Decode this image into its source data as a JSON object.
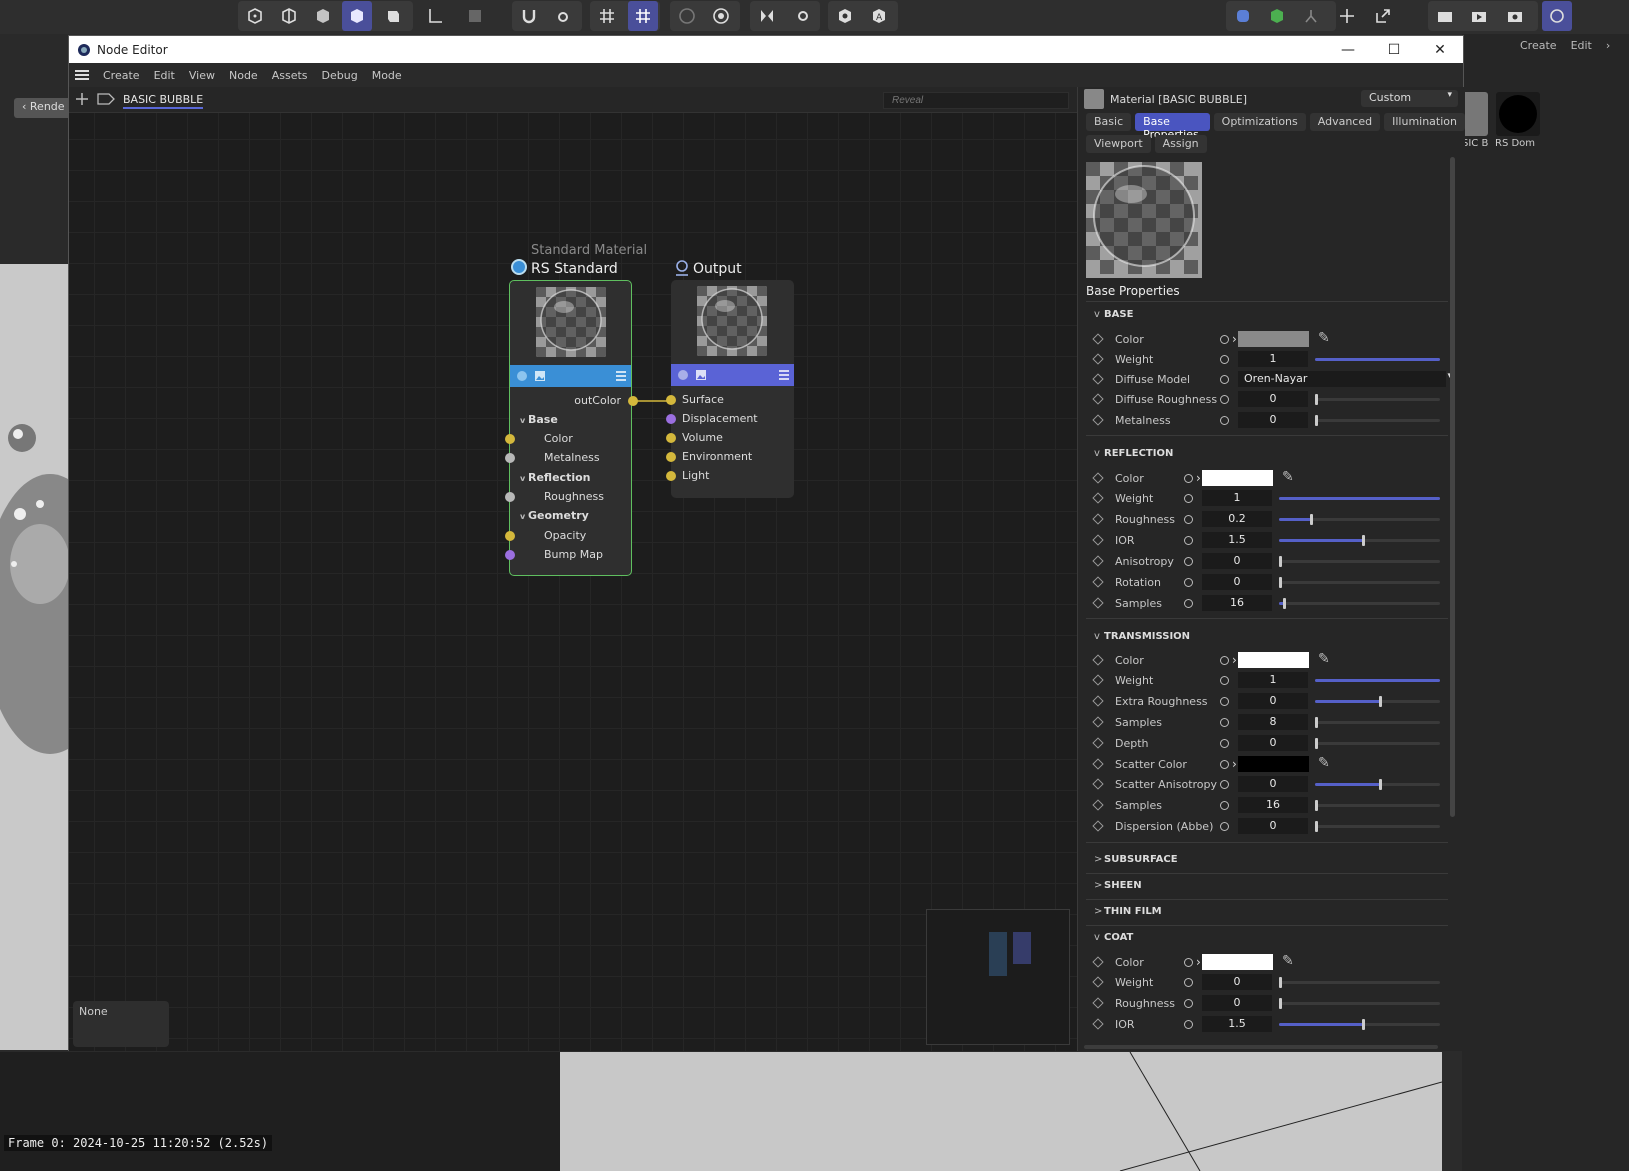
{
  "app": {
    "right_menu": [
      "Create",
      "Edit"
    ],
    "left_tab_label": "Rende",
    "material_thumbs": [
      {
        "label": "SIC B"
      },
      {
        "label": "RS Dom"
      }
    ],
    "frame_label": "Frame  0: 2024-10-25 11:20:52 (2.52s)"
  },
  "window": {
    "title": "Node Editor",
    "controls": {
      "minimize": "—",
      "maximize": "☐",
      "close": "✕"
    }
  },
  "menu": [
    "Create",
    "Edit",
    "View",
    "Node",
    "Assets",
    "Debug",
    "Mode"
  ],
  "graph": {
    "tab": "BASIC BUBBLE",
    "reveal_placeholder": "Reveal",
    "none_label": "None",
    "rs_node": {
      "subtitle": "Standard Material",
      "title": "RS Standard",
      "output_port": "outColor",
      "groups": [
        {
          "label": "Base",
          "ports": [
            "Color",
            "Metalness"
          ]
        },
        {
          "label": "Reflection",
          "ports": [
            "Roughness"
          ]
        },
        {
          "label": "Geometry",
          "ports": [
            "Opacity",
            "Bump Map"
          ]
        }
      ]
    },
    "output_node": {
      "title": "Output",
      "ports": [
        "Surface",
        "Displacement",
        "Volume",
        "Environment",
        "Light"
      ]
    },
    "colors": {
      "rs_bar": "#3a8fd6",
      "output_bar": "#5a63d6",
      "selected_border": "#5fbf5f",
      "port_yellow": "#d4b83c",
      "port_purple": "#9b6fe0",
      "port_grey": "#b8b8b8"
    }
  },
  "attributes": {
    "header": "Material [BASIC BUBBLE]",
    "preset": "Custom",
    "tabs_row1": [
      "Basic",
      "Base Properties",
      "Optimizations",
      "Advanced",
      "Illumination"
    ],
    "tabs_row2": [
      "Viewport",
      "Assign"
    ],
    "active_tab": "Base Properties",
    "section_title": "Base Properties",
    "groups": {
      "base": {
        "label": "BASE",
        "color_label": "Color",
        "weight_label": "Weight",
        "weight": "1",
        "diffuse_model_label": "Diffuse Model",
        "diffuse_model": "Oren-Nayar",
        "diffuse_roughness_label": "Diffuse Roughness",
        "diffuse_roughness": "0",
        "metalness_label": "Metalness",
        "metalness": "0",
        "base_color": "#8a8a8a"
      },
      "reflection": {
        "label": "REFLECTION",
        "color_label": "Color",
        "weight_label": "Weight",
        "weight": "1",
        "roughness_label": "Roughness",
        "roughness": "0.2",
        "ior_label": "IOR",
        "ior": "1.5",
        "anisotropy_label": "Anisotropy",
        "anisotropy": "0",
        "rotation_label": "Rotation",
        "rotation": "0",
        "samples_label": "Samples",
        "samples": "16"
      },
      "transmission": {
        "label": "TRANSMISSION",
        "color_label": "Color",
        "weight_label": "Weight",
        "weight": "1",
        "extra_roughness_label": "Extra Roughness",
        "extra_roughness": "0",
        "samples_label": "Samples",
        "samples": "8",
        "depth_label": "Depth",
        "depth": "0",
        "scatter_color_label": "Scatter Color",
        "scatter_anisotropy_label": "Scatter Anisotropy",
        "scatter_anisotropy": "0",
        "samples2_label": "Samples",
        "samples2": "16",
        "dispersion_label": "Dispersion (Abbe)",
        "dispersion": "0"
      },
      "subsurface": {
        "label": "SUBSURFACE"
      },
      "sheen": {
        "label": "SHEEN"
      },
      "thin_film": {
        "label": "THIN FILM"
      },
      "coat": {
        "label": "COAT",
        "color_label": "Color",
        "weight_label": "Weight",
        "weight": "0",
        "roughness_label": "Roughness",
        "roughness": "0",
        "ior_label": "IOR",
        "ior": "1.5"
      }
    },
    "slider_levels": {
      "base_weight": 1.0,
      "diffuse_roughness": 0.0,
      "metalness": 0.0,
      "refl_weight": 1.0,
      "refl_roughness": 0.2,
      "refl_ior": 0.52,
      "refl_anisotropy": 0.0,
      "refl_rotation": 0.0,
      "refl_samples": 0.03,
      "trans_weight": 1.0,
      "extra_roughness": 0.52,
      "trans_samples": 0.0,
      "depth": 0.0,
      "scatter_anisotropy": 0.52,
      "trans_samples2": 0.0,
      "dispersion": 0.0,
      "coat_weight": 0.0,
      "coat_roughness": 0.0,
      "coat_ior": 0.52
    }
  }
}
